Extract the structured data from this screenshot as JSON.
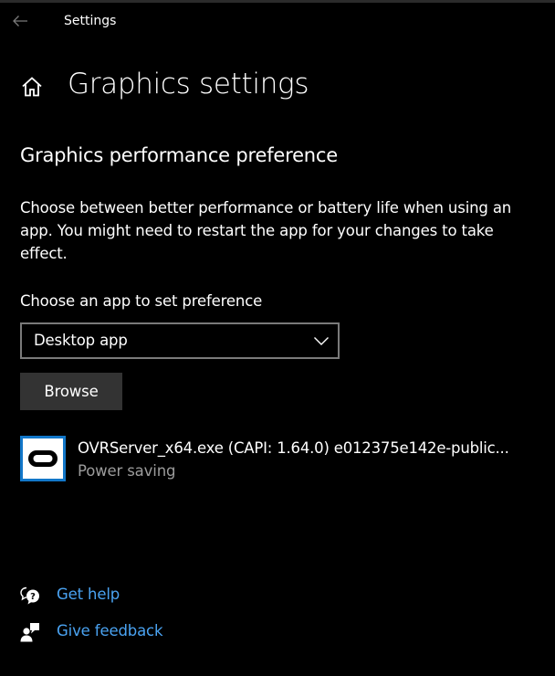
{
  "window": {
    "app_title": "Settings"
  },
  "page": {
    "title": "Graphics settings"
  },
  "section": {
    "title": "Graphics performance preference",
    "description": "Choose between better performance or battery life when using an app. You might need to restart the app for your changes to take effect."
  },
  "app_picker": {
    "label": "Choose an app to set preference",
    "selected": "Desktop app",
    "browse_label": "Browse"
  },
  "apps": [
    {
      "name": "OVRServer_x64.exe (CAPI: 1.64.0) e012375e142e-public...",
      "preference": "Power saving",
      "icon": "oculus-icon"
    }
  ],
  "links": {
    "help_label": "Get help",
    "feedback_label": "Give feedback"
  },
  "colors": {
    "background": "#000000",
    "link": "#4aa3f2",
    "app_icon_tile": "#1277c9",
    "button": "#333333",
    "secondary_text": "#9c9c9c"
  },
  "icons": {
    "back": "back-arrow-icon",
    "home": "home-icon",
    "dropdown": "chevron-down-icon",
    "help": "help-chat-icon",
    "feedback": "feedback-person-icon"
  }
}
